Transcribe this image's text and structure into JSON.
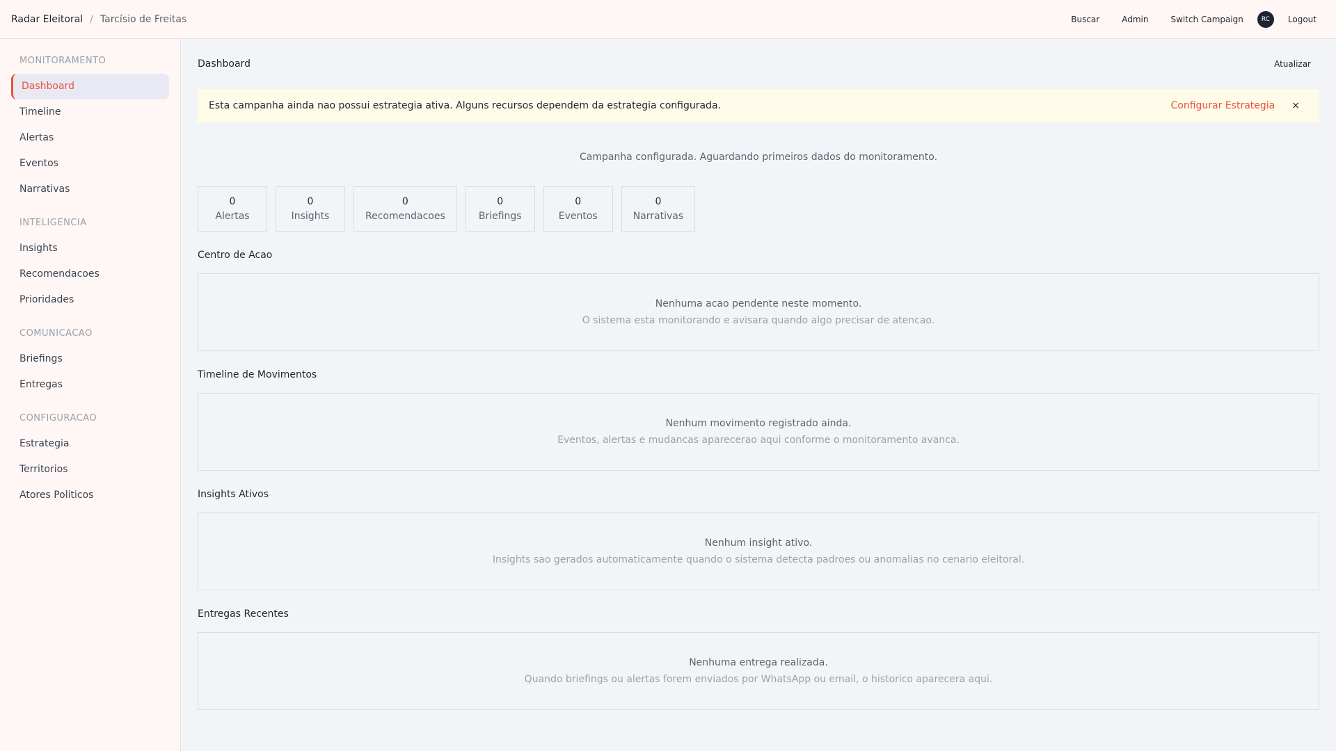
{
  "header": {
    "app_name": "Radar Eleitoral",
    "separator": "/",
    "campaign_name": "Tarcísio de Freitas",
    "nav": {
      "search": "Buscar",
      "admin": "Admin",
      "switch_campaign": "Switch Campaign",
      "avatar_initials": "RC",
      "logout": "Logout"
    }
  },
  "sidebar": {
    "sections": [
      {
        "title": "MONITORAMENTO",
        "items": [
          "Dashboard",
          "Timeline",
          "Alertas",
          "Eventos",
          "Narrativas"
        ]
      },
      {
        "title": "INTELIGENCIA",
        "items": [
          "Insights",
          "Recomendacoes",
          "Prioridades"
        ]
      },
      {
        "title": "COMUNICACAO",
        "items": [
          "Briefings",
          "Entregas"
        ]
      },
      {
        "title": "CONFIGURACAO",
        "items": [
          "Estrategia",
          "Territorios",
          "Atores Politicos"
        ]
      }
    ],
    "active_item": "Dashboard"
  },
  "page": {
    "title": "Dashboard",
    "refresh_label": "Atualizar"
  },
  "alert": {
    "text": "Esta campanha ainda nao possui estrategia ativa. Alguns recursos dependem da estrategia configurada.",
    "action_label": "Configurar Estrategia",
    "close_label": "×"
  },
  "status_message": "Campanha configurada. Aguardando primeiros dados do monitoramento.",
  "stats": [
    {
      "value": "0",
      "label": "Alertas"
    },
    {
      "value": "0",
      "label": "Insights"
    },
    {
      "value": "0",
      "label": "Recomendacoes"
    },
    {
      "value": "0",
      "label": "Briefings"
    },
    {
      "value": "0",
      "label": "Eventos"
    },
    {
      "value": "0",
      "label": "Narrativas"
    }
  ],
  "blocks": [
    {
      "title": "Centro de Acao",
      "empty_main": "Nenhuma acao pendente neste momento.",
      "empty_sub": "O sistema esta monitorando e avisara quando algo precisar de atencao."
    },
    {
      "title": "Timeline de Movimentos",
      "empty_main": "Nenhum movimento registrado ainda.",
      "empty_sub": "Eventos, alertas e mudancas aparecerao aqui conforme o monitoramento avanca."
    },
    {
      "title": "Insights Ativos",
      "empty_main": "Nenhum insight ativo.",
      "empty_sub": "Insights sao gerados automaticamente quando o sistema detecta padroes ou anomalias no cenario eleitoral."
    },
    {
      "title": "Entregas Recentes",
      "empty_main": "Nenhuma entrega realizada.",
      "empty_sub": "Quando briefings ou alertas forem enviados por WhatsApp ou email, o historico aparecera aqui."
    }
  ],
  "colors": {
    "accent": "#e8533a",
    "alert_bg": "#fffbe9",
    "sidebar_bg": "#fff7f5",
    "main_bg": "#f3f4f8",
    "avatar_bg": "#1e2333"
  }
}
